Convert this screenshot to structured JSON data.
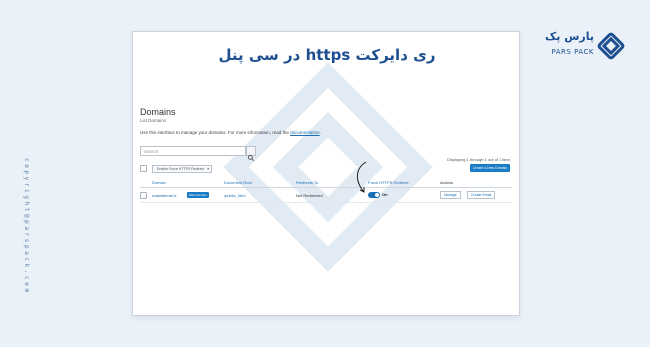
{
  "header": {
    "title": "ری دایرکت https در سی پنل"
  },
  "brand": {
    "name_fa": "پارس پک",
    "name_en": "PARS PACK",
    "side_text": "copyright@parspack.com"
  },
  "page": {
    "heading": "Domains",
    "subheading": "List Domains",
    "description": "Use this interface to manage your domains. For more information, read the",
    "doc_link": "documentation",
    "search_placeholder": "Search",
    "showing": "Displaying 1 through 1 out of 1 item",
    "create_button": "Create A New Domain",
    "enable_select": "Enable Force HTTPS Redirect"
  },
  "table": {
    "columns": [
      "Domain",
      "Document Root",
      "Redirects To",
      "Force HTTPS Redirect",
      "Actions"
    ],
    "rows": [
      {
        "domain": "mastaferrari.ir",
        "badge": "Main Domain",
        "document_root": "/public_html",
        "redirects_to": "Not Redirected",
        "force_https": "On",
        "actions": [
          "Manage",
          "Create Email"
        ]
      }
    ]
  },
  "colors": {
    "accent": "#1a6fb4",
    "title": "#1d4f91",
    "background": "#eaf1f8"
  }
}
